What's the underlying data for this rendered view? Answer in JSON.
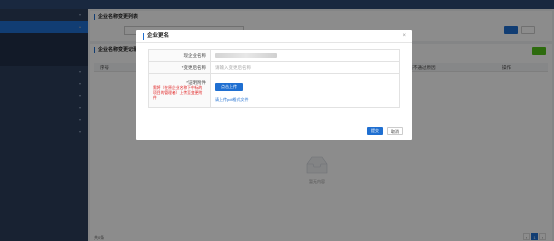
{
  "topbar": {
    "title": "",
    "right_text": ""
  },
  "sidebar": {
    "items": [
      {
        "label": ""
      },
      {
        "label": ""
      },
      {
        "label": ""
      },
      {
        "label": ""
      },
      {
        "label": ""
      },
      {
        "label": ""
      },
      {
        "label": ""
      },
      {
        "label": ""
      }
    ],
    "group": {
      "label": ""
    },
    "subs": [
      {
        "label": ""
      },
      {
        "label": ""
      },
      {
        "label": ""
      }
    ]
  },
  "search_panel": {
    "title": "企业名称变更列表",
    "label": "",
    "search_btn": "",
    "reset_btn": ""
  },
  "list_panel": {
    "title": "企业名称变更记录",
    "add_btn": "",
    "columns": [
      "序号",
      "审核不通过原因",
      "操作"
    ],
    "empty_text": "暂无内容",
    "total_text": "共0条",
    "pages": [
      "‹",
      "1",
      "›"
    ]
  },
  "modal": {
    "title": "企业更名",
    "current_name_label": "现企业名称",
    "new_name_label": "*变更后名称",
    "new_name_placeholder": "请输入变更后名称",
    "proof_label": "*证明附件",
    "proof_warning": "需将（在原企业名称下中标的项目的管理者）上传至变更附件",
    "upload_btn": "点击上传",
    "template_link": "请上传pdf格式文件",
    "submit_btn": "提交",
    "cancel_btn": "取消"
  },
  "colors": {
    "primary": "#1f6fd1",
    "sidebar": "#2c3e5c",
    "warning": "#e02020"
  },
  "icons": {
    "close": "close-icon",
    "chevron": "chevron-down-icon",
    "empty": "empty-box-icon"
  }
}
